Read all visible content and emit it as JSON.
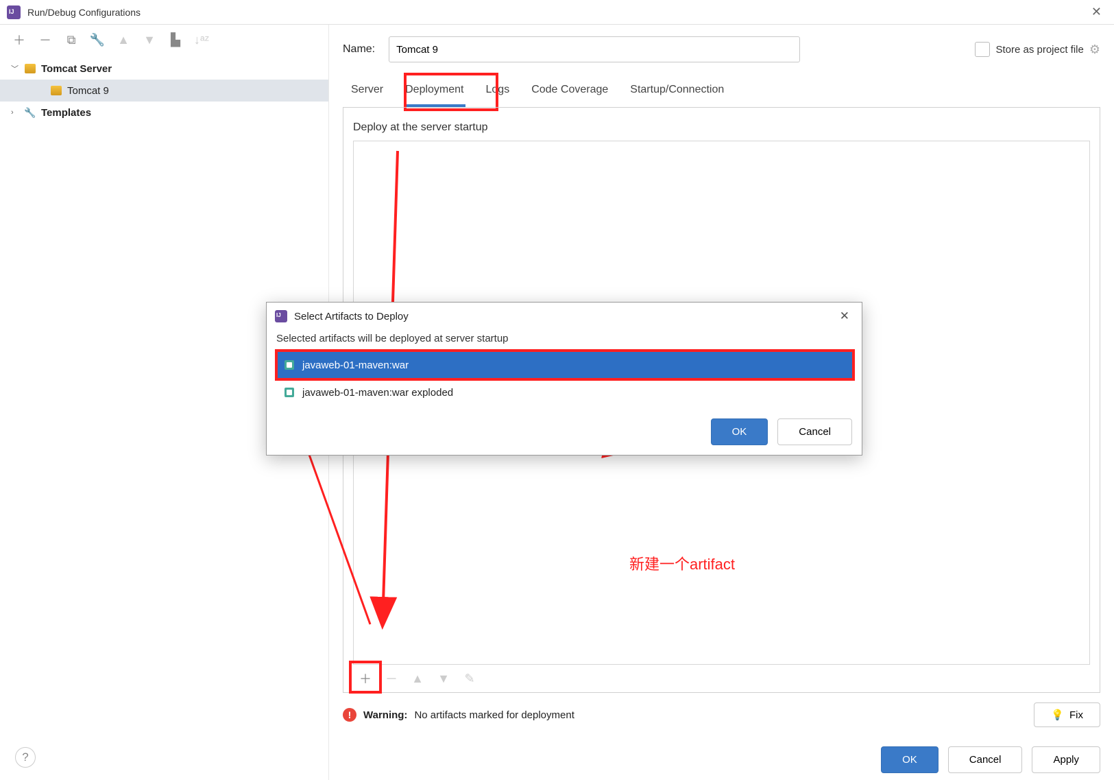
{
  "window": {
    "title": "Run/Debug Configurations"
  },
  "tree": {
    "node_server": "Tomcat Server",
    "node_instance": "Tomcat 9",
    "node_templates": "Templates"
  },
  "right": {
    "name_label": "Name:",
    "name_value": "Tomcat 9",
    "store_label": "Store as project file"
  },
  "tabs": {
    "server": "Server",
    "deployment": "Deployment",
    "logs": "Logs",
    "coverage": "Code Coverage",
    "startup": "Startup/Connection"
  },
  "deploy": {
    "section_title": "Deploy at the server startup"
  },
  "warning": {
    "label": "Warning:",
    "text": "No artifacts marked for deployment",
    "fix": "Fix"
  },
  "inner": {
    "title": "Select Artifacts to Deploy",
    "desc": "Selected artifacts will be deployed at server startup",
    "artifact1": "javaweb-01-maven:war",
    "artifact2": "javaweb-01-maven:war exploded",
    "ok": "OK",
    "cancel": "Cancel"
  },
  "footer": {
    "ok": "OK",
    "cancel": "Cancel",
    "apply": "Apply"
  },
  "annotation": "新建一个artifact"
}
